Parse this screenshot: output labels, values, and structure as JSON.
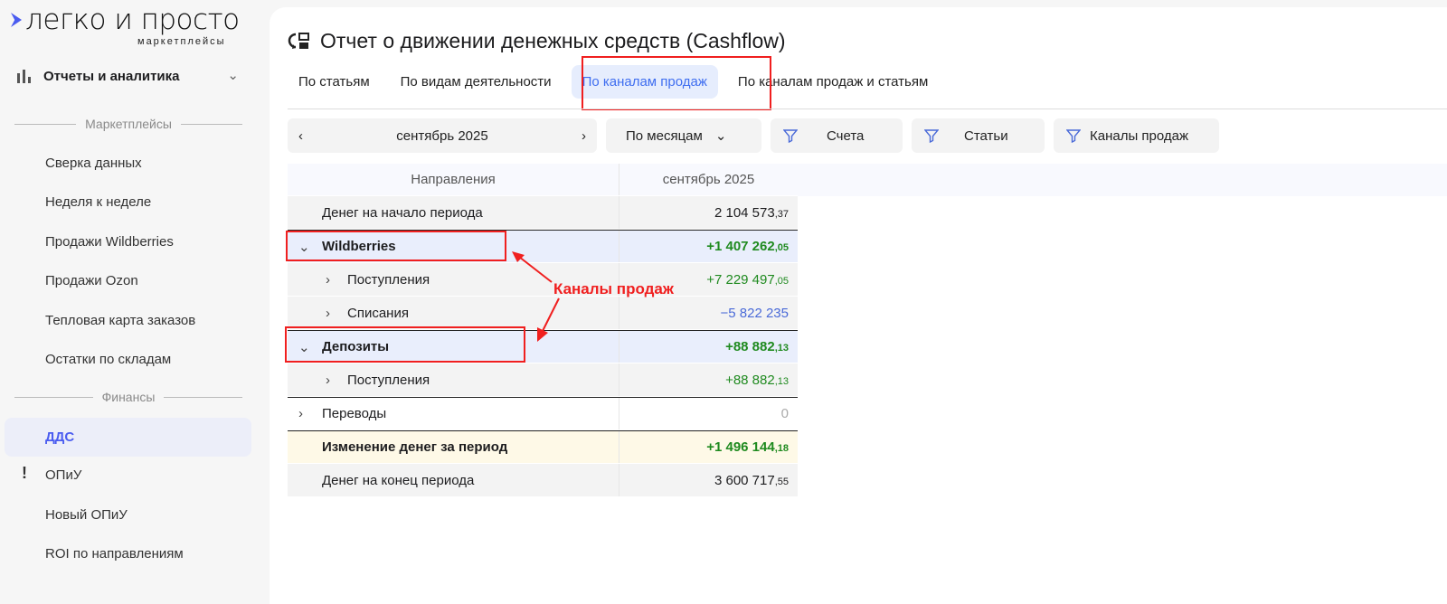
{
  "logo": {
    "main": "легко и просто",
    "sub": "маркетплейсы"
  },
  "sidebar": {
    "section": "Отчеты и аналитика",
    "group1": "Маркетплейсы",
    "items1": [
      "Сверка данных",
      "Неделя к неделе",
      "Продажи Wildberries",
      "Продажи Ozon",
      "Тепловая карта заказов",
      "Остатки по складам"
    ],
    "group2": "Финансы",
    "active": "ДДС",
    "items2": [
      "ОПиУ",
      "Новый ОПиУ",
      "ROI по направлениям"
    ],
    "warn": "!"
  },
  "page": {
    "title": "Отчет о движении денежных средств (Cashflow)"
  },
  "tabs": [
    "По статьям",
    "По видам деятельности",
    "По каналам продаж",
    "По каналам продаж и статьям"
  ],
  "filters": {
    "period": "сентябрь 2025",
    "grouping": "По месяцам",
    "accounts": "Счета",
    "articles": "Статьи",
    "channels": "Каналы продаж"
  },
  "table": {
    "headers": [
      "Направления",
      "сентябрь 2025"
    ],
    "rows": [
      {
        "label": "Денег на начало периода",
        "int": "2 104 573",
        "dec": ",37"
      },
      {
        "label": "Wildberries",
        "int": "+1 407 262",
        "dec": ",05"
      },
      {
        "label": "Поступления",
        "int": "+7 229 497",
        "dec": ",05"
      },
      {
        "label": "Списания",
        "int": "−5 822 235",
        "dec": ""
      },
      {
        "label": "Депозиты",
        "int": "+88 882",
        "dec": ",13"
      },
      {
        "label": "Поступления",
        "int": "+88 882",
        "dec": ",13"
      },
      {
        "label": "Переводы",
        "int": "0",
        "dec": ""
      },
      {
        "label": "Изменение денег за период",
        "int": "+1 496 144",
        "dec": ",18"
      },
      {
        "label": "Денег на конец периода",
        "int": "3 600 717",
        "dec": ",55"
      }
    ]
  },
  "annotation": "Каналы продаж",
  "colors": {
    "accent": "#4a5cf0",
    "positive": "#1f8a1f",
    "negative": "#4a6ad8",
    "annotation": "#f01f1f"
  }
}
